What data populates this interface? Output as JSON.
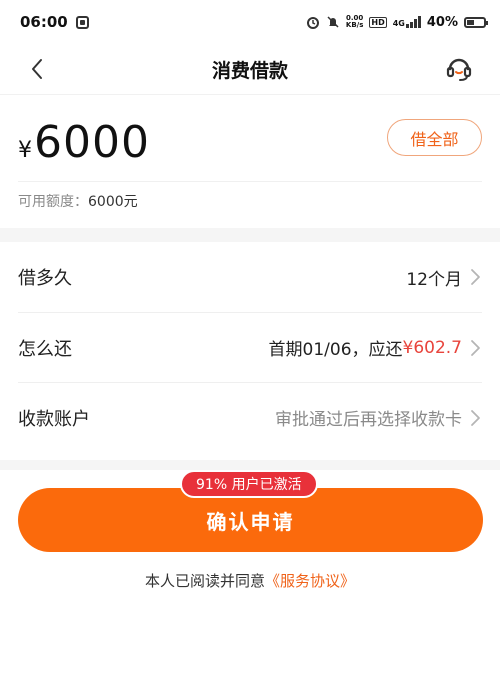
{
  "status_bar": {
    "time": "06:00",
    "net_speed_value": "0.00",
    "net_speed_unit": "KB/s",
    "hd": "HD",
    "network": "4G",
    "battery": "40%"
  },
  "nav": {
    "title": "消费借款",
    "back_icon": "chevron-left-icon",
    "service_icon": "headset-icon"
  },
  "amount": {
    "currency": "¥",
    "value": "6000",
    "borrow_all_label": "借全部",
    "available_label": "可用额度：",
    "available_value": "6000元"
  },
  "options": [
    {
      "label": "借多久",
      "value": "12个月"
    },
    {
      "label": "怎么还",
      "value_prefix": "首期01/06，应还",
      "value_accent": "¥602.7"
    },
    {
      "label": "收款账户",
      "value": "审批通过后再选择收款卡"
    }
  ],
  "confirm": {
    "label": "确认申请",
    "badge": "91% 用户已激活"
  },
  "agreement": {
    "text": "本人已阅读并同意",
    "link": "《服务协议》"
  },
  "colors": {
    "primary": "#fb6a0c",
    "badge": "#e8313a",
    "accent_text": "#e8443c",
    "link": "#f0631a"
  }
}
